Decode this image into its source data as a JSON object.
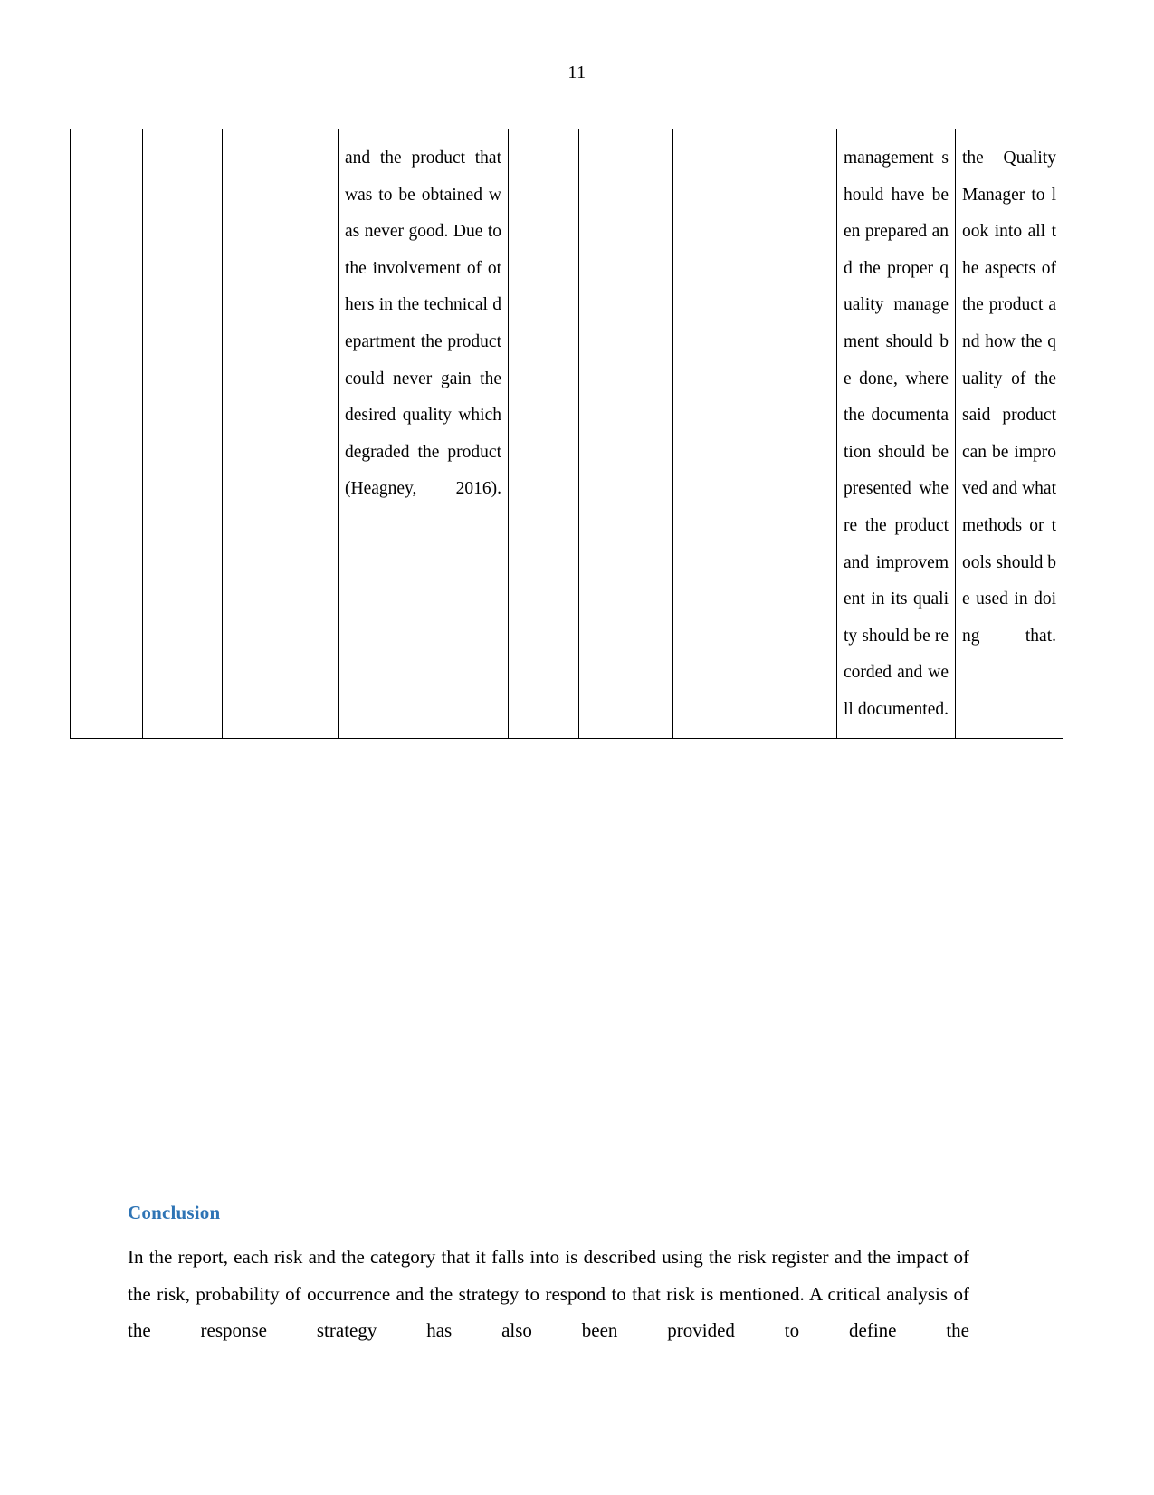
{
  "document": {
    "page_number": "11",
    "accent_color": "#2e74b5",
    "text_color": "#000000",
    "background_color": "#ffffff"
  },
  "table": {
    "columns": 10,
    "row": {
      "col1": "",
      "col2": "",
      "col3": "",
      "col4": "and the product that was to be obtained was never good. Due to the involvement of others in the technical department the product could never gain the desired quality which degraded the product (Heagney, 2016).",
      "col5": "",
      "col6": "",
      "col7": "",
      "col8": "",
      "col9": "management should have been prepared and the proper quality management should be done, where the documentation should be presented where the product and improvement in its quality should be recorded and well documented.",
      "col10": "the Quality Manager to look into all the aspects of the product and how the quality of the said product can be improved and what methods or tools should be used in doing that."
    }
  },
  "conclusion": {
    "heading": "Conclusion",
    "paragraph": "In the report, each risk and the category that it falls into is described using the risk register and the impact of the risk, probability of occurrence and the strategy to respond to that risk is mentioned. A critical analysis of the response strategy has also been provided to define the"
  }
}
